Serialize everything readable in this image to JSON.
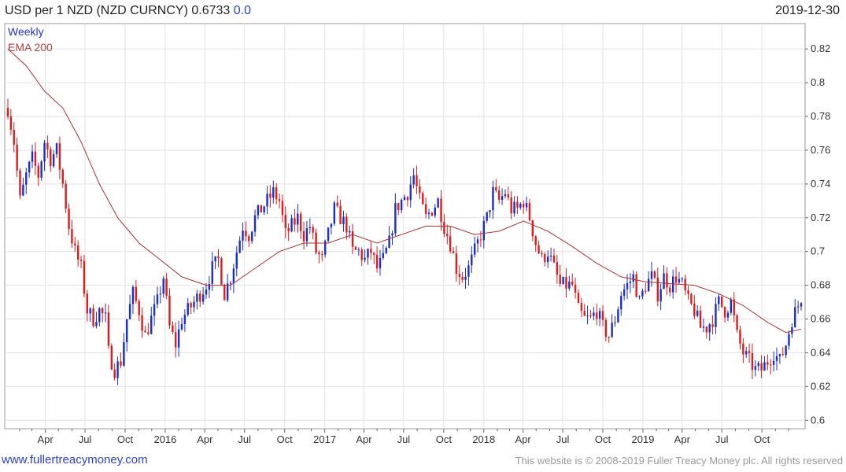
{
  "header": {
    "title": "USD per 1 NZD (NZD CURNCY) 0.6733",
    "change": "0.0",
    "date": "2019-12-30"
  },
  "footer": {
    "site": "www.fullertreacymoney.com",
    "copyright": "This website is © 2008-2019 Fuller Treacy Money plc. All rights reserved"
  },
  "colors": {
    "up": "#1a2ec8",
    "down": "#e01b1b",
    "ema": "#b03030",
    "grid": "#e2e2e2"
  },
  "chart_data": {
    "type": "candlestick",
    "frequency": "Weekly",
    "series": [
      {
        "name": "Weekly"
      },
      {
        "name": "EMA 200"
      }
    ],
    "yticks": [
      0.6,
      0.62,
      0.64,
      0.66,
      0.68,
      0.7,
      0.72,
      0.74,
      0.76,
      0.78,
      0.8,
      0.82
    ],
    "ytick_labels": [
      "0.6",
      "0.62",
      "0.64",
      "0.66",
      "0.68",
      "0.7",
      "0.72",
      "0.74",
      "0.76",
      "0.78",
      "0.8",
      "0.82"
    ],
    "ylim": [
      0.595,
      0.835
    ],
    "xtick_labels": [
      "Apr",
      "Jul",
      "Oct",
      "2016",
      "Apr",
      "Jul",
      "Oct",
      "2017",
      "Apr",
      "Jul",
      "Oct",
      "2018",
      "Apr",
      "Jul",
      "Oct",
      "2019",
      "Apr",
      "Jul",
      "Oct"
    ],
    "x_start": "2015-01-05",
    "x_end": "2019-12-30",
    "close_path": [
      [
        "2015-01-05",
        0.785
      ],
      [
        "2015-01-19",
        0.765
      ],
      [
        "2015-02-02",
        0.73
      ],
      [
        "2015-02-16",
        0.745
      ],
      [
        "2015-03-02",
        0.755
      ],
      [
        "2015-03-16",
        0.745
      ],
      [
        "2015-03-30",
        0.765
      ],
      [
        "2015-04-13",
        0.755
      ],
      [
        "2015-04-27",
        0.76
      ],
      [
        "2015-05-11",
        0.74
      ],
      [
        "2015-05-25",
        0.715
      ],
      [
        "2015-06-08",
        0.7
      ],
      [
        "2015-06-22",
        0.69
      ],
      [
        "2015-07-06",
        0.665
      ],
      [
        "2015-07-20",
        0.66
      ],
      [
        "2015-08-03",
        0.665
      ],
      [
        "2015-08-17",
        0.66
      ],
      [
        "2015-08-24",
        0.64
      ],
      [
        "2015-09-07",
        0.63
      ],
      [
        "2015-09-21",
        0.635
      ],
      [
        "2015-10-05",
        0.66
      ],
      [
        "2015-10-19",
        0.675
      ],
      [
        "2015-11-02",
        0.665
      ],
      [
        "2015-11-16",
        0.65
      ],
      [
        "2015-11-30",
        0.66
      ],
      [
        "2015-12-14",
        0.67
      ],
      [
        "2015-12-28",
        0.685
      ],
      [
        "2016-01-11",
        0.655
      ],
      [
        "2016-01-25",
        0.645
      ],
      [
        "2016-02-08",
        0.66
      ],
      [
        "2016-02-22",
        0.665
      ],
      [
        "2016-03-07",
        0.67
      ],
      [
        "2016-03-21",
        0.675
      ],
      [
        "2016-04-04",
        0.68
      ],
      [
        "2016-04-18",
        0.69
      ],
      [
        "2016-05-02",
        0.695
      ],
      [
        "2016-05-16",
        0.675
      ],
      [
        "2016-05-30",
        0.685
      ],
      [
        "2016-06-13",
        0.7
      ],
      [
        "2016-06-27",
        0.715
      ],
      [
        "2016-07-11",
        0.71
      ],
      [
        "2016-07-25",
        0.72
      ],
      [
        "2016-08-08",
        0.725
      ],
      [
        "2016-08-22",
        0.73
      ],
      [
        "2016-09-05",
        0.735
      ],
      [
        "2016-09-19",
        0.73
      ],
      [
        "2016-10-03",
        0.71
      ],
      [
        "2016-10-17",
        0.715
      ],
      [
        "2016-10-31",
        0.72
      ],
      [
        "2016-11-14",
        0.71
      ],
      [
        "2016-11-28",
        0.715
      ],
      [
        "2016-12-12",
        0.7
      ],
      [
        "2016-12-26",
        0.695
      ],
      [
        "2017-01-09",
        0.71
      ],
      [
        "2017-01-23",
        0.725
      ],
      [
        "2017-02-06",
        0.72
      ],
      [
        "2017-02-20",
        0.715
      ],
      [
        "2017-03-06",
        0.7
      ],
      [
        "2017-03-20",
        0.7
      ],
      [
        "2017-04-03",
        0.695
      ],
      [
        "2017-04-17",
        0.7
      ],
      [
        "2017-05-01",
        0.69
      ],
      [
        "2017-05-15",
        0.695
      ],
      [
        "2017-05-29",
        0.705
      ],
      [
        "2017-06-12",
        0.725
      ],
      [
        "2017-06-26",
        0.73
      ],
      [
        "2017-07-10",
        0.735
      ],
      [
        "2017-07-24",
        0.745
      ],
      [
        "2017-08-07",
        0.73
      ],
      [
        "2017-08-21",
        0.72
      ],
      [
        "2017-09-04",
        0.725
      ],
      [
        "2017-09-18",
        0.73
      ],
      [
        "2017-10-02",
        0.715
      ],
      [
        "2017-10-16",
        0.705
      ],
      [
        "2017-10-30",
        0.69
      ],
      [
        "2017-11-13",
        0.685
      ],
      [
        "2017-11-27",
        0.69
      ],
      [
        "2017-12-11",
        0.7
      ],
      [
        "2017-12-25",
        0.71
      ],
      [
        "2018-01-08",
        0.72
      ],
      [
        "2018-01-22",
        0.735
      ],
      [
        "2018-02-05",
        0.73
      ],
      [
        "2018-02-19",
        0.735
      ],
      [
        "2018-03-05",
        0.725
      ],
      [
        "2018-03-19",
        0.725
      ],
      [
        "2018-04-02",
        0.73
      ],
      [
        "2018-04-16",
        0.72
      ],
      [
        "2018-04-30",
        0.705
      ],
      [
        "2018-05-14",
        0.695
      ],
      [
        "2018-05-28",
        0.7
      ],
      [
        "2018-06-11",
        0.69
      ],
      [
        "2018-06-25",
        0.68
      ],
      [
        "2018-07-09",
        0.68
      ],
      [
        "2018-07-23",
        0.68
      ],
      [
        "2018-08-06",
        0.665
      ],
      [
        "2018-08-20",
        0.66
      ],
      [
        "2018-09-03",
        0.66
      ],
      [
        "2018-09-17",
        0.665
      ],
      [
        "2018-10-01",
        0.655
      ],
      [
        "2018-10-15",
        0.65
      ],
      [
        "2018-10-29",
        0.66
      ],
      [
        "2018-11-12",
        0.675
      ],
      [
        "2018-11-26",
        0.68
      ],
      [
        "2018-12-10",
        0.685
      ],
      [
        "2018-12-24",
        0.67
      ],
      [
        "2019-01-07",
        0.68
      ],
      [
        "2019-01-21",
        0.685
      ],
      [
        "2019-02-04",
        0.675
      ],
      [
        "2019-02-18",
        0.685
      ],
      [
        "2019-03-04",
        0.68
      ],
      [
        "2019-03-18",
        0.685
      ],
      [
        "2019-04-01",
        0.68
      ],
      [
        "2019-04-15",
        0.67
      ],
      [
        "2019-04-29",
        0.665
      ],
      [
        "2019-05-13",
        0.655
      ],
      [
        "2019-05-27",
        0.655
      ],
      [
        "2019-06-10",
        0.66
      ],
      [
        "2019-06-24",
        0.67
      ],
      [
        "2019-07-08",
        0.665
      ],
      [
        "2019-07-22",
        0.67
      ],
      [
        "2019-08-05",
        0.65
      ],
      [
        "2019-08-19",
        0.64
      ],
      [
        "2019-09-02",
        0.635
      ],
      [
        "2019-09-16",
        0.63
      ],
      [
        "2019-09-30",
        0.63
      ],
      [
        "2019-10-14",
        0.635
      ],
      [
        "2019-10-28",
        0.64
      ],
      [
        "2019-11-11",
        0.635
      ],
      [
        "2019-11-25",
        0.645
      ],
      [
        "2019-12-09",
        0.66
      ],
      [
        "2019-12-23",
        0.668
      ],
      [
        "2019-12-30",
        0.673
      ]
    ],
    "ema_200": [
      [
        "2015-01-05",
        0.82
      ],
      [
        "2015-02-16",
        0.81
      ],
      [
        "2015-03-30",
        0.795
      ],
      [
        "2015-05-11",
        0.785
      ],
      [
        "2015-06-22",
        0.765
      ],
      [
        "2015-08-03",
        0.74
      ],
      [
        "2015-09-14",
        0.72
      ],
      [
        "2015-11-02",
        0.705
      ],
      [
        "2015-12-21",
        0.695
      ],
      [
        "2016-02-08",
        0.685
      ],
      [
        "2016-04-04",
        0.68
      ],
      [
        "2016-05-30",
        0.68
      ],
      [
        "2016-07-25",
        0.69
      ],
      [
        "2016-09-19",
        0.7
      ],
      [
        "2016-11-14",
        0.705
      ],
      [
        "2017-01-09",
        0.705
      ],
      [
        "2017-03-06",
        0.71
      ],
      [
        "2017-05-01",
        0.705
      ],
      [
        "2017-06-26",
        0.71
      ],
      [
        "2017-08-21",
        0.715
      ],
      [
        "2017-10-16",
        0.715
      ],
      [
        "2017-12-11",
        0.71
      ],
      [
        "2018-02-05",
        0.712
      ],
      [
        "2018-04-02",
        0.718
      ],
      [
        "2018-05-28",
        0.712
      ],
      [
        "2018-07-23",
        0.703
      ],
      [
        "2018-09-17",
        0.693
      ],
      [
        "2018-11-12",
        0.685
      ],
      [
        "2019-01-07",
        0.682
      ],
      [
        "2019-03-04",
        0.681
      ],
      [
        "2019-04-29",
        0.68
      ],
      [
        "2019-06-24",
        0.675
      ],
      [
        "2019-08-19",
        0.668
      ],
      [
        "2019-10-14",
        0.658
      ],
      [
        "2019-11-25",
        0.652
      ],
      [
        "2019-12-30",
        0.654
      ]
    ],
    "legend_placement": "top-left",
    "grid": true
  }
}
